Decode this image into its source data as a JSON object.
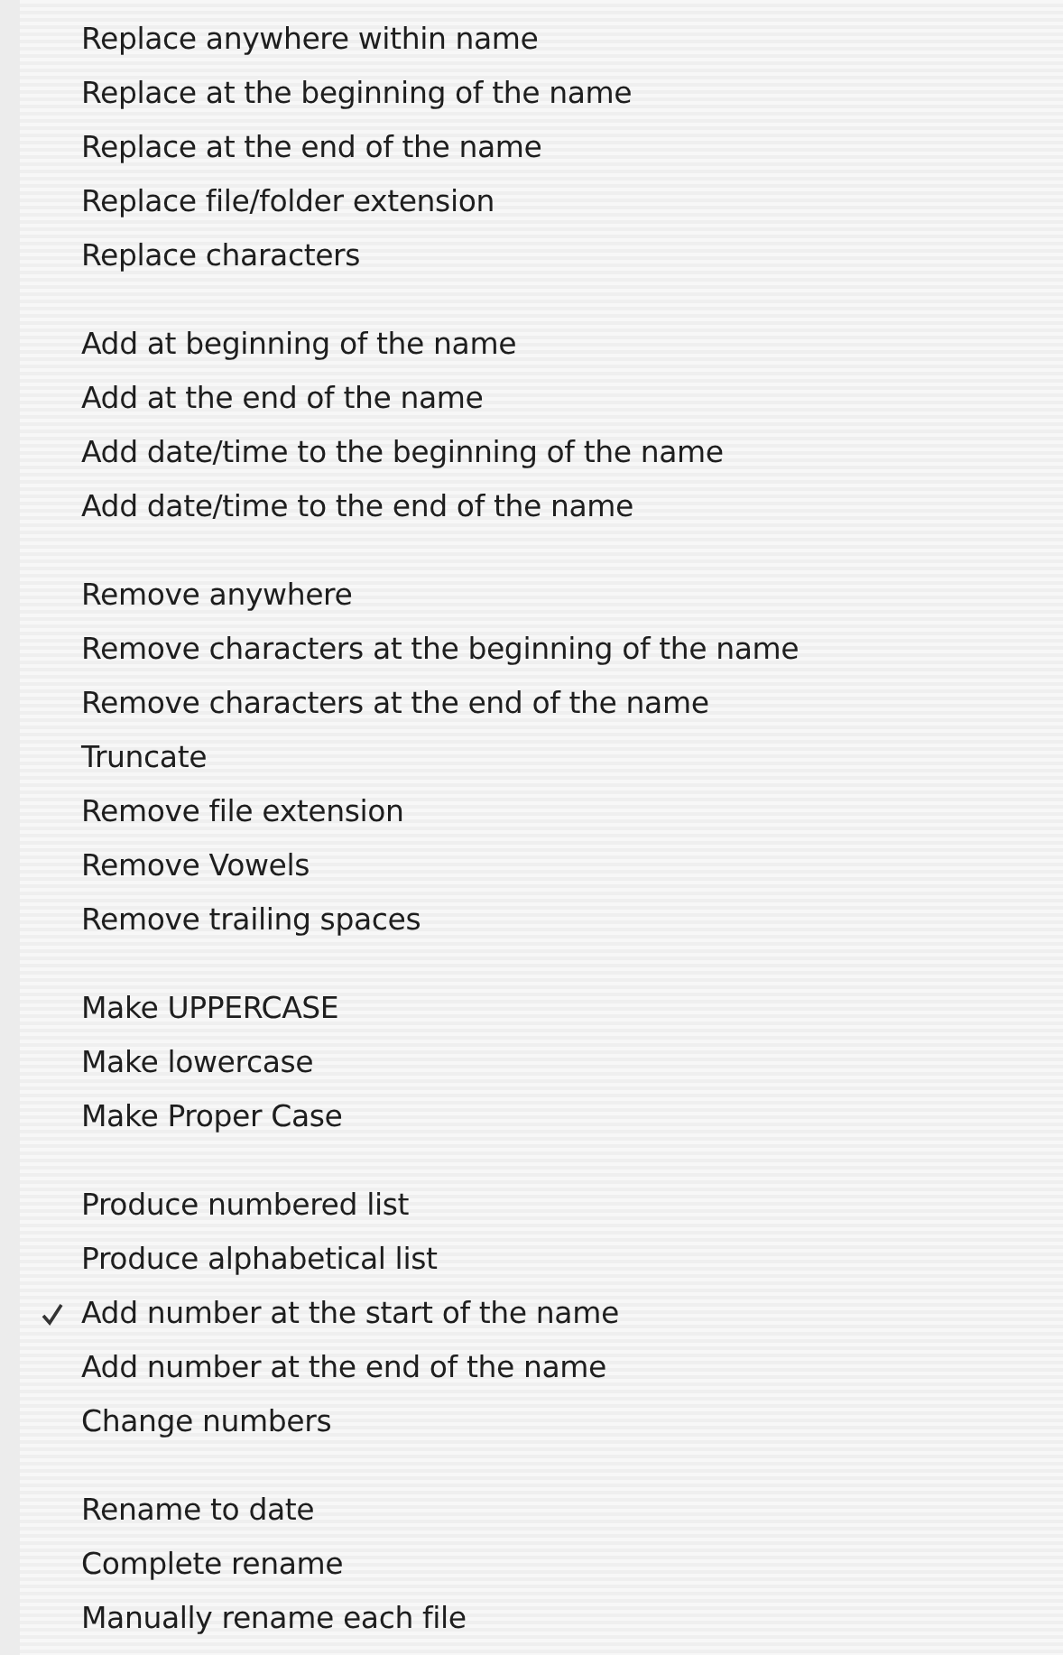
{
  "menu": {
    "groups": [
      {
        "items": [
          {
            "label": "Replace anywhere within name",
            "checked": false
          },
          {
            "label": "Replace at the beginning of the name",
            "checked": false
          },
          {
            "label": "Replace at the end of the name",
            "checked": false
          },
          {
            "label": "Replace file/folder extension",
            "checked": false
          },
          {
            "label": "Replace characters",
            "checked": false
          }
        ]
      },
      {
        "items": [
          {
            "label": "Add at beginning of the name",
            "checked": false
          },
          {
            "label": "Add at the end of the name",
            "checked": false
          },
          {
            "label": "Add date/time to the beginning of the name",
            "checked": false
          },
          {
            "label": "Add date/time to the end of the name",
            "checked": false
          }
        ]
      },
      {
        "items": [
          {
            "label": "Remove anywhere",
            "checked": false
          },
          {
            "label": "Remove characters at the beginning of the name",
            "checked": false
          },
          {
            "label": "Remove characters at the end of the name",
            "checked": false
          },
          {
            "label": "Truncate",
            "checked": false
          },
          {
            "label": "Remove file extension",
            "checked": false
          },
          {
            "label": "Remove Vowels",
            "checked": false
          },
          {
            "label": "Remove trailing spaces",
            "checked": false
          }
        ]
      },
      {
        "items": [
          {
            "label": "Make UPPERCASE",
            "checked": false
          },
          {
            "label": "Make lowercase",
            "checked": false
          },
          {
            "label": "Make Proper Case",
            "checked": false
          }
        ]
      },
      {
        "items": [
          {
            "label": "Produce numbered list",
            "checked": false
          },
          {
            "label": "Produce alphabetical list",
            "checked": false
          },
          {
            "label": "Add number at the start of the name",
            "checked": true
          },
          {
            "label": "Add number at the end of the name",
            "checked": false
          },
          {
            "label": "Change numbers",
            "checked": false
          }
        ]
      },
      {
        "items": [
          {
            "label": "Rename to date",
            "checked": false
          },
          {
            "label": "Complete rename",
            "checked": false
          },
          {
            "label": "Manually rename each file",
            "checked": false
          }
        ]
      }
    ]
  }
}
